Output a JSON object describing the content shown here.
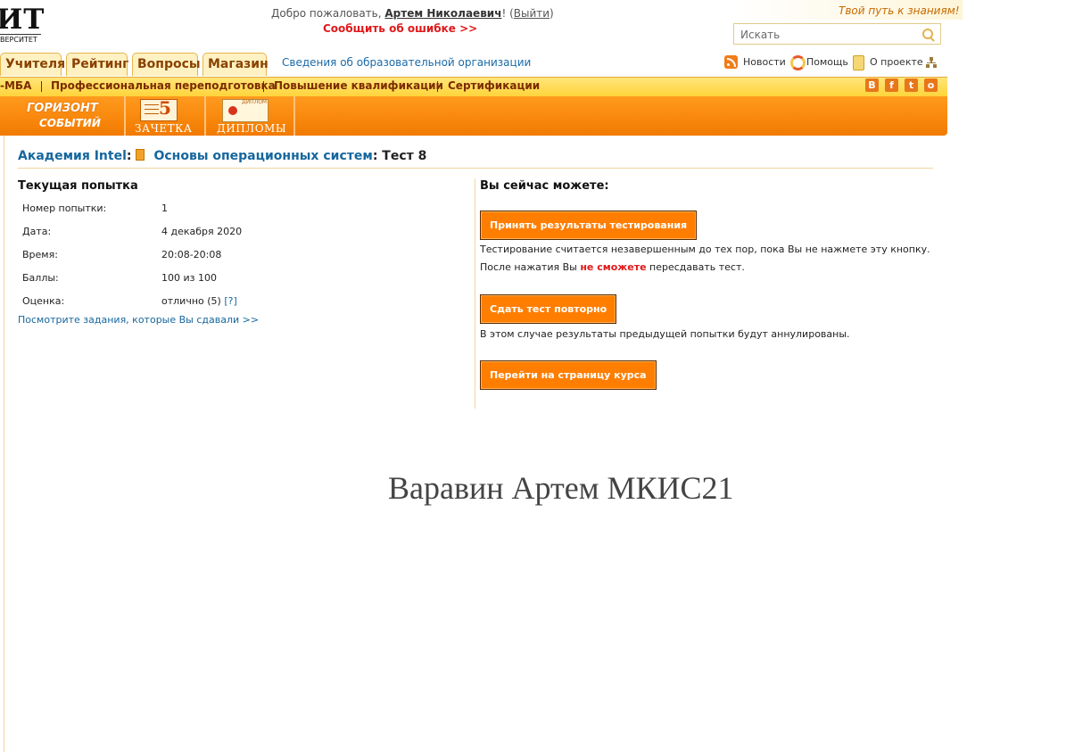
{
  "header": {
    "logo_big": "ИТ",
    "logo_small": "ВЕРСИТЕТ",
    "welcome_prefix": "Добро пожаловать, ",
    "user_name": "Артем Николаевич",
    "welcome_after_name": "! (",
    "logout": "Выйти",
    "welcome_suffix": ")",
    "report_error": "Сообщить об ошибке >>",
    "slogan": "Твой путь к знаниям!",
    "search_placeholder": "Искать"
  },
  "tabs": [
    "Учителя",
    "Рейтинг",
    "Вопросы",
    "Магазин"
  ],
  "org_link": "Сведения об образовательной организации",
  "toplinks": {
    "news": "Новости",
    "help": "Помощь",
    "about": "О проекте"
  },
  "programs_bar": {
    "items": [
      "-МБА",
      "Профессиональная переподготовка",
      "Повышение квалификации",
      "Сертификации"
    ],
    "social": [
      "В",
      "f",
      "t",
      "о"
    ],
    "social_colors": [
      "#e8761a",
      "#e8761a",
      "#e8761a",
      "#e8761a"
    ]
  },
  "orange_bar": {
    "horizon_line1": "ГОРИЗОНТ",
    "horizon_line2": "СОБЫТИЙ",
    "gradebook_digit": "5",
    "gradebook_label": "ЗАЧЕТКА",
    "diploma_tiny": "ДИПЛОМ",
    "diploma_label": "ДИПЛОМЫ"
  },
  "breadcrumb": {
    "academy": "Академия Intel",
    "course": "Основы операционных систем",
    "test": "Тест 8"
  },
  "attempt": {
    "heading": "Текущая попытка",
    "rows": [
      {
        "label": "Номер попытки:",
        "value": "1"
      },
      {
        "label": "Дата:",
        "value": "4 декабря 2020"
      },
      {
        "label": "Время:",
        "value": "20:08-20:08"
      },
      {
        "label": "Баллы:",
        "value": "100 из 100"
      },
      {
        "label": "Оценка:",
        "value": "отлично (5)",
        "hint": "[?]"
      }
    ],
    "tasks_link": "Посмотрите задания, которые Вы сдавали >>"
  },
  "actions": {
    "heading": "Вы сейчас можете:",
    "accept_button": "Принять результаты тестирования",
    "accept_note_line1": "Тестирование считается незавершенным до тех пор, пока Вы не нажмете эту кнопку.",
    "accept_note_line2_prefix": "После нажатия Вы ",
    "accept_note_line2_red": "не сможете",
    "accept_note_line2_suffix": " пересдавать тест.",
    "retake_button": "Сдать тест повторно",
    "retake_note": "В этом случае результаты предыдущей попытки будут аннулированы.",
    "course_button": "Перейти на страницу курса"
  },
  "signature": "Варавин Артем МКИС21"
}
